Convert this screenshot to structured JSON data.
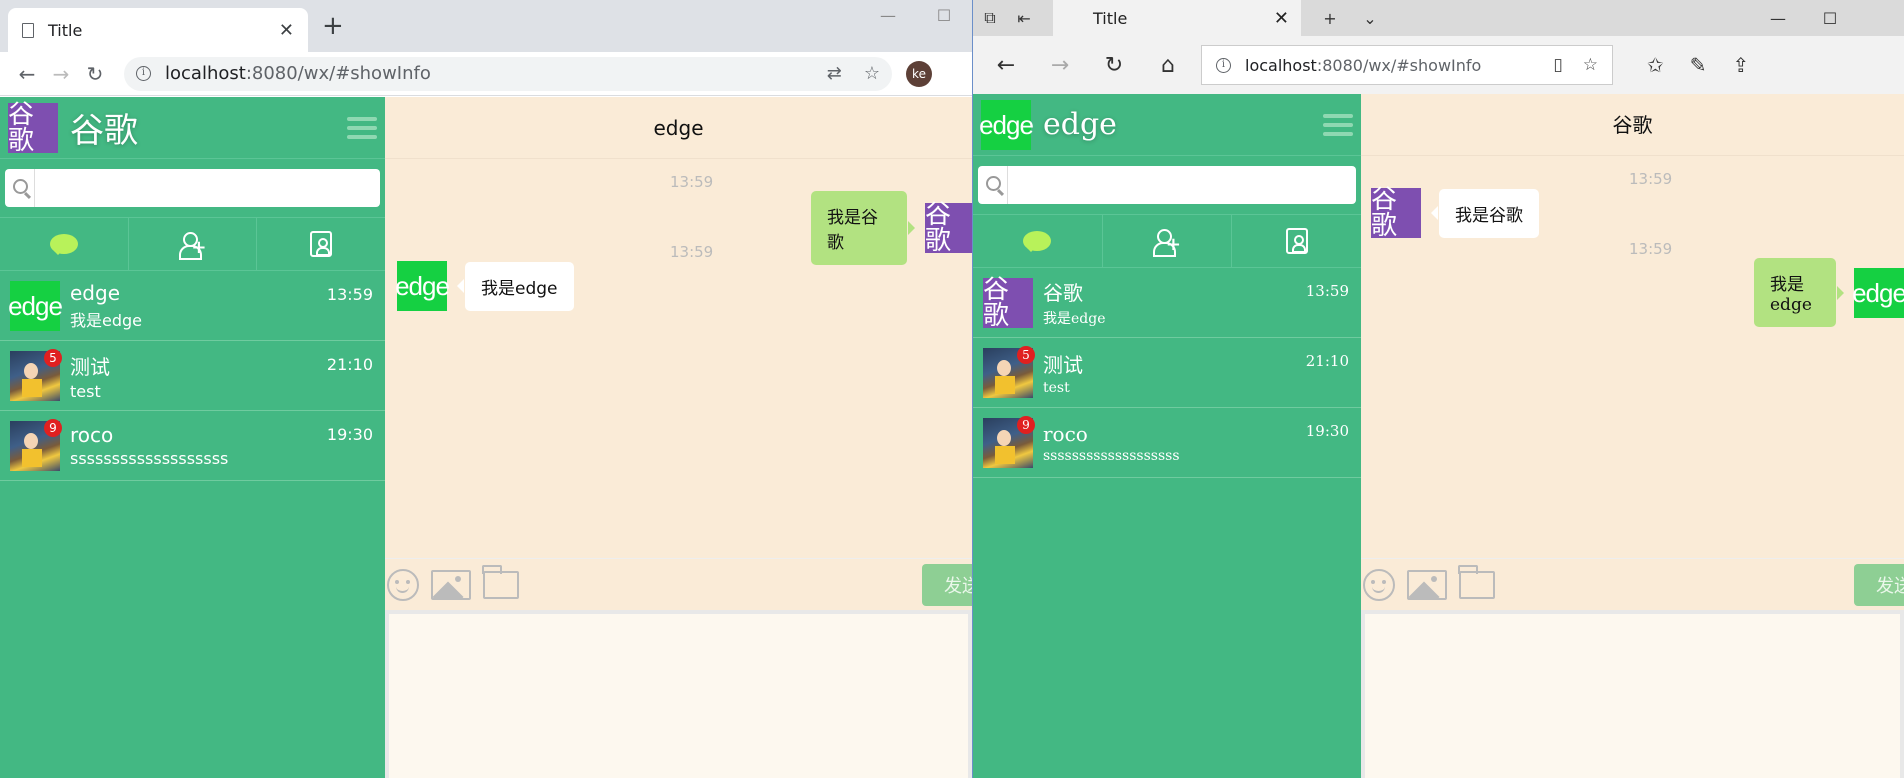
{
  "chrome": {
    "tab_title": "Title",
    "new_tab": "+",
    "url_host": "localhost",
    "url_rest": ":8080/wx/#showInfo",
    "profile": "ke",
    "user": {
      "name": "谷歌",
      "logo_text": "谷歌"
    },
    "chat_title": "edge",
    "send_label": "发送"
  },
  "edge": {
    "tab_title": "Title",
    "url_host": "localhost",
    "url_rest": ":8080/wx/#showInfo",
    "user": {
      "name": "edge",
      "logo_text": "edge"
    },
    "chat_title": "谷歌",
    "send_label": "发送"
  },
  "chrome_convs": [
    {
      "name": "edge",
      "msg": "我是edge",
      "time": "13:59",
      "avatar": "edge",
      "badge": ""
    },
    {
      "name": "测试",
      "msg": "test",
      "time": "21:10",
      "avatar": "",
      "badge": "5"
    },
    {
      "name": "roco",
      "msg": "sssssssssssssssssss",
      "time": "19:30",
      "avatar": "",
      "badge": "9"
    }
  ],
  "edge_convs": [
    {
      "name": "谷歌",
      "msg": "我是edge",
      "time": "13:59",
      "avatar": "谷歌",
      "badge": ""
    },
    {
      "name": "测试",
      "msg": "test",
      "time": "21:10",
      "avatar": "",
      "badge": "5"
    },
    {
      "name": "roco",
      "msg": "sssssssssssssssssss",
      "time": "19:30",
      "avatar": "",
      "badge": "9"
    }
  ],
  "chrome_messages": [
    {
      "time": "13:59",
      "text": "我是谷歌",
      "avatar": "谷歌"
    },
    {
      "time": "13:59",
      "text": "我是edge",
      "avatar": "edge"
    }
  ],
  "edge_messages": [
    {
      "time": "13:59",
      "text": "我是谷歌",
      "avatar": "谷歌"
    },
    {
      "time": "13:59",
      "text": "我是edge",
      "avatar": "edge"
    }
  ],
  "colors": {
    "sidebar": "#43b883",
    "chat_bg": "#faebd7",
    "purple_logo": "#7e4fb0",
    "green_logo": "#15d042",
    "bubble_green": "#b2e281"
  }
}
